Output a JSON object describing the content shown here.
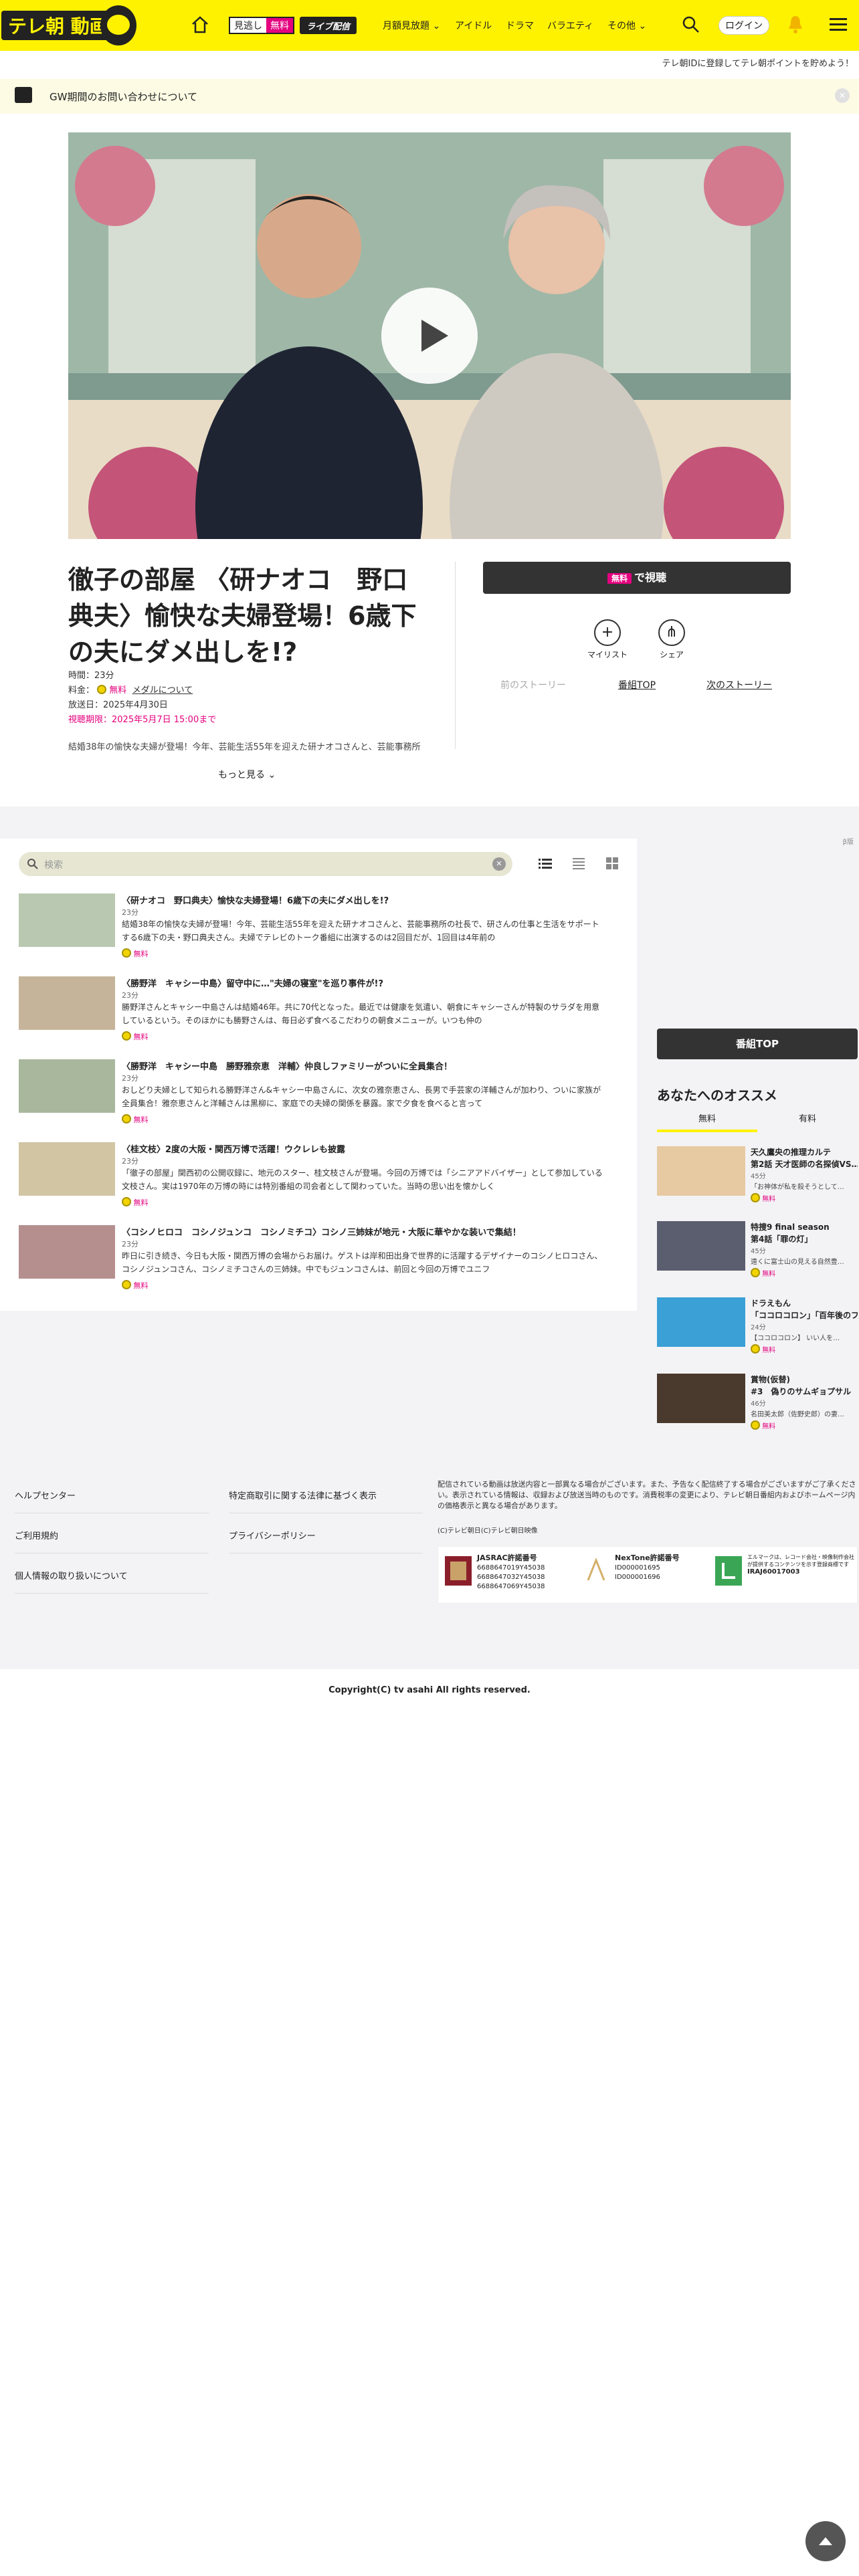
{
  "header": {
    "logo_text": "テレ朝 動画",
    "badge_free_left": "見逃し",
    "badge_free_right": "無料",
    "badge_live": "ライブ配信",
    "nav": [
      "月額見放題",
      "アイドル",
      "ドラマ",
      "バラエティ",
      "その他"
    ],
    "login": "ログイン"
  },
  "promo_line": "テレ朝IDに登録してテレ朝ポイントを貯めよう！",
  "notice": {
    "text": "GW期間のお問い合わせについて",
    "close": "✕"
  },
  "program": {
    "title": "徹子の部屋 〈研ナオコ　野口典夫〉愉快な夫婦登場！6歳下の夫にダメ出しを!?",
    "duration_label": "時間：23分",
    "price_label": "料金：",
    "price_value": "無料",
    "media_link": "メダルについて",
    "aired": "放送日：2025年4月30日",
    "deadline": "視聴期限：2025年5月7日 15:00まで",
    "description": "結婚38年の愉快な夫婦が登場！今年、芸能生活55年を迎えた研ナオコさんと、芸能事務所",
    "more": "もっと見る",
    "watch_tag": "無料",
    "watch_label": "で視聴",
    "mylist": "マイリスト",
    "share": "シェア",
    "prev_story": "前のストーリー",
    "program_top": "番組TOP",
    "next_story": "次のストーリー"
  },
  "beta_label": "β版",
  "search": {
    "placeholder": "検索",
    "clear": "✕"
  },
  "episodes": [
    {
      "title": "〈研ナオコ　野口典夫〉愉快な夫婦登場！6歳下の夫にダメ出しを!?",
      "duration": "23分",
      "summary": "結婚38年の愉快な夫婦が登場！今年、芸能生活55年を迎えた研ナオコさんと、芸能事務所の社長で、研さんの仕事と生活をサポートする6歳下の夫・野口典夫さん。夫婦でテレビのトーク番組に出演するのは2回目だが、1回目は4年前の",
      "free": "無料"
    },
    {
      "title": "〈勝野洋　キャシー中島〉留守中に…\"夫婦の寝室\"を巡り事件が!?",
      "duration": "23分",
      "summary": "勝野洋さんとキャシー中島さんは結婚46年。共に70代となった。最近では健康を気遣い、朝食にキャシーさんが特製のサラダを用意しているという。そのほかにも勝野さんは、毎日必ず食べるこだわりの朝食メニューが。いつも仲の",
      "free": "無料"
    },
    {
      "title": "〈勝野洋　キャシー中島　勝野雅奈恵　洋輔〉仲良しファミリーがついに全員集合！",
      "duration": "23分",
      "summary": "おしどり夫婦として知られる勝野洋さん&キャシー中島さんに、次女の雅奈恵さん、長男で手芸家の洋輔さんが加わり、ついに家族が全員集合！雅奈恵さんと洋輔さんは黒柳に、家庭での夫婦の関係を暴露。家で夕食を食べると言って",
      "free": "無料"
    },
    {
      "title": "〈桂文枝〉2度の大阪・関西万博で活躍！ウクレレも披露",
      "duration": "23分",
      "summary": "「徹子の部屋」関西初の公開収録に、地元のスター、桂文枝さんが登場。今回の万博では「シニアアドバイザー」として参加している文枝さん。実は1970年の万博の時には特別番組の司会者として関わっていた。当時の思い出を懐かしく",
      "free": "無料"
    },
    {
      "title": "〈コシノヒロコ　コシノジュンコ　コシノミチコ〉コシノ三姉妹が地元・大阪に華やかな装いで集結！",
      "duration": "23分",
      "summary": "昨日に引き続き、今日も大阪・関西万博の会場からお届け。ゲストは岸和田出身で世界的に活躍するデザイナーのコシノヒロコさん、コシノジュンコさん、コシノミチコさんの三姉妹。中でもジュンコさんは、前回と今回の万博でユニフ",
      "free": "無料"
    }
  ],
  "sidebar": {
    "program_top": "番組TOP",
    "rec_title": "あなたへのオススメ",
    "tabs": [
      "無料",
      "有料"
    ],
    "items": [
      {
        "t1": "天久鷹央の推理カルテ",
        "t2": "第2話 天才医師の名探偵VS…",
        "dur": "45分",
        "sum": "「お神体が私を殺そうとして…",
        "free": "無料"
      },
      {
        "t1": "特捜9 final season",
        "t2": "第4話「罪の灯」",
        "dur": "45分",
        "sum": "遠くに富士山の見える自然豊…",
        "free": "無料"
      },
      {
        "t1": "ドラえもん",
        "t2": "「ココロコロン」「百年後のフ…",
        "dur": "24分",
        "sum": "【ココロコロン】 いい人を…",
        "free": "無料"
      },
      {
        "t1": "賞物(仮替)",
        "t2": "#3　偽りのサムギョプサル",
        "dur": "46分",
        "sum": "名田美太郎（佐野史郎）の妻…",
        "free": "無料"
      }
    ]
  },
  "footer": {
    "links_left": [
      "ヘルプセンター",
      "ご利用規約",
      "個人情報の取り扱いについて"
    ],
    "links_right": [
      "特定商取引に関する法律に基づく表示",
      "プライバシーポリシー"
    ],
    "note": "配信されている動画は放送内容と一部異なる場合がございます。また、予告なく配信終了する場合がございますがご了承ください。表示されている情報は、収録および放送当時のものです。消費税率の変更により、テレビ朝日番組内およびホームページ内の価格表示と異なる場合があります。",
    "cr_note": "(C)テレビ朝日(C)テレビ朝日映像",
    "jasrac_title": "JASRAC許諾番号",
    "jasrac_nums": [
      "6688647019Y45038",
      "6688647032Y45038",
      "6688647069Y45038"
    ],
    "nextone_title": "NexTone許諾番号",
    "nextone_nums": [
      "ID000001695",
      "ID000001696"
    ],
    "l_note": "エルマークは、レコード会社・映像制作会社が提供するコンテンツを示す登録商標です",
    "l_code": "IRAJ60017003",
    "copyright": "Copyright(C) tv asahi All rights reserved."
  }
}
